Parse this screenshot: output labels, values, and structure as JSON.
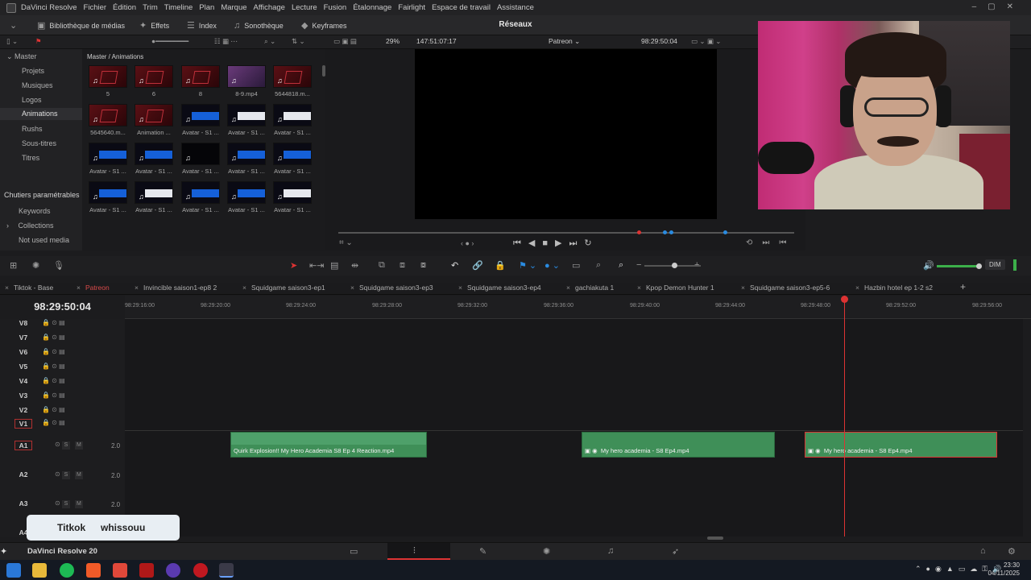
{
  "menu": [
    "DaVinci Resolve",
    "Fichier",
    "Édition",
    "Trim",
    "Timeline",
    "Plan",
    "Marque",
    "Affichage",
    "Lecture",
    "Fusion",
    "Étalonnage",
    "Fairlight",
    "Espace de travail",
    "Assistance"
  ],
  "toolbar": {
    "media_library": "Bibliothèque de médias",
    "effects": "Effets",
    "index": "Index",
    "sound_library": "Sonothèque",
    "keyframes": "Keyframes",
    "page_title": "Réseaux"
  },
  "viewer": {
    "zoom": "29%",
    "source_timecode": "147:51:07:17",
    "timeline_name": "Patreon",
    "record_timecode": "98:29:50:04"
  },
  "sidebar": {
    "root": "Master",
    "items": [
      "Projets",
      "Musiques",
      "Logos",
      "Animations",
      "Rushs",
      "Sous-titres",
      "Titres"
    ],
    "smart_bins_title": "Chutiers paramétrables",
    "smart_bins": [
      "Keywords",
      "Collections",
      "Not used media"
    ]
  },
  "media_pool": {
    "path": "Master / Animations",
    "clips": [
      {
        "label": "5",
        "kind": "red"
      },
      {
        "label": "6",
        "kind": "red"
      },
      {
        "label": "8",
        "kind": "red"
      },
      {
        "label": "8-9.mp4",
        "kind": "photo"
      },
      {
        "label": "5644818.m...",
        "kind": "red"
      },
      {
        "label": "5645640.m...",
        "kind": "red"
      },
      {
        "label": "Animation ...",
        "kind": "red"
      },
      {
        "label": "Avatar - S1 ...",
        "kind": "blue"
      },
      {
        "label": "Avatar - S1 ...",
        "kind": "white"
      },
      {
        "label": "Avatar - S1 ...",
        "kind": "white"
      },
      {
        "label": "Avatar - S1 ...",
        "kind": "blue"
      },
      {
        "label": "Avatar - S1 ...",
        "kind": "blue"
      },
      {
        "label": "Avatar - S1 ...",
        "kind": "dark"
      },
      {
        "label": "Avatar - S1 ...",
        "kind": "blue"
      },
      {
        "label": "Avatar - S1 ...",
        "kind": "blue"
      },
      {
        "label": "Avatar - S1 ...",
        "kind": "blue"
      },
      {
        "label": "Avatar - S1 ...",
        "kind": "white"
      },
      {
        "label": "Avatar - S1 ...",
        "kind": "blue"
      },
      {
        "label": "Avatar - S1 ...",
        "kind": "blue"
      },
      {
        "label": "Avatar - S1 ...",
        "kind": "white"
      }
    ]
  },
  "edit_tools": {
    "dim": "DIM"
  },
  "timeline_tabs": [
    "Tiktok - Base",
    "Patreon",
    "Invincible saison1-ep8 2",
    "Squidgame saison3-ep1",
    "Squidgame saison3-ep3",
    "Squidgame saison3-ep4",
    "gachiakuta 1",
    "Kpop Demon Hunter 1",
    "Squidgame saison3-ep5-6",
    "Hazbin hotel ep 1-2 s2"
  ],
  "timeline": {
    "timecode": "98:29:50:04",
    "ruler": [
      "98:29:16:00",
      "98:29:20:00",
      "98:29:24:00",
      "98:29:28:00",
      "98:29:32:00",
      "98:29:36:00",
      "98:29:40:00",
      "98:29:44:00",
      "98:29:48:00",
      "98:29:52:00",
      "98:29:56:00"
    ],
    "video_tracks": [
      "V8",
      "V7",
      "V6",
      "V5",
      "V4",
      "V3",
      "V2",
      "V1"
    ],
    "audio_tracks": [
      {
        "name": "A1",
        "level": "2.0"
      },
      {
        "name": "A2",
        "level": "2.0"
      },
      {
        "name": "A3",
        "level": "2.0"
      },
      {
        "name": "A4",
        "level": ""
      }
    ],
    "solo": "S",
    "mute": "M",
    "clips": [
      {
        "label": "Quirk Explosion!!  My Hero Academia S8 Ep 4 Reaction.mp4"
      },
      {
        "label": "My hero academia - S8 Ep4.mp4"
      },
      {
        "label": "My hero academia - S8 Ep4.mp4"
      }
    ]
  },
  "subtitle_chip": {
    "left": "Titkok",
    "right": "whissouu"
  },
  "pagebar": {
    "brand": "DaVinci Resolve 20"
  },
  "clock": {
    "time": "23:30",
    "date": "04/11/2025"
  },
  "colors": {
    "accent": "#d33333",
    "clip": "#3f8f58",
    "level_green": "#3cb04a"
  }
}
